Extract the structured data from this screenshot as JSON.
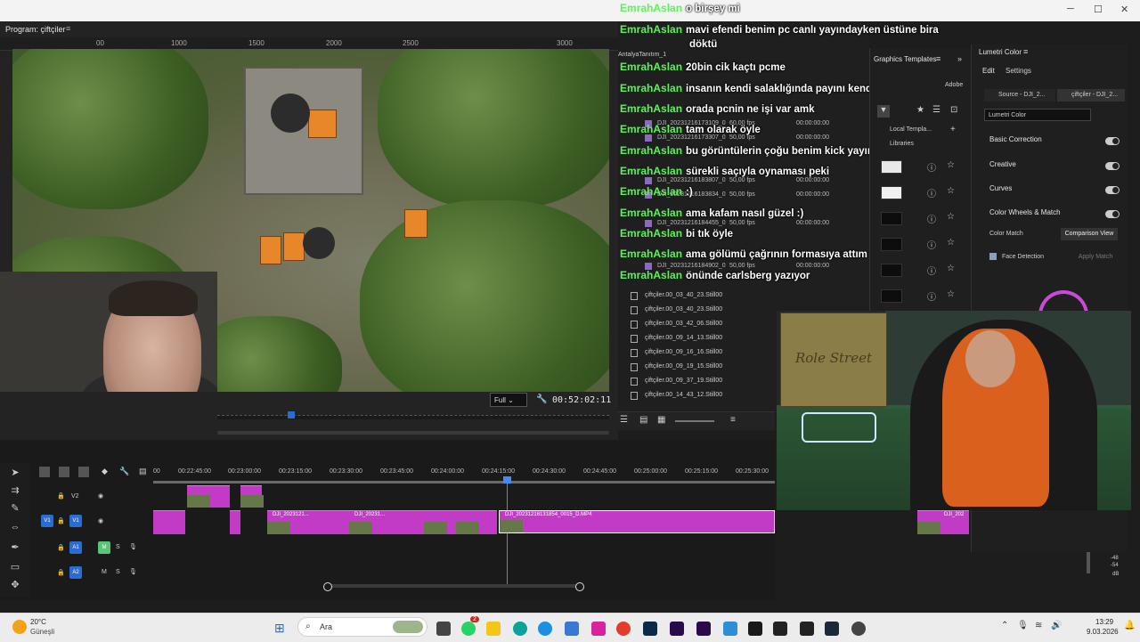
{
  "program": {
    "tab_label": "Program: çiftçiler",
    "ruler": [
      "00",
      "1000",
      "1500",
      "2000",
      "2500",
      "3000"
    ],
    "fit": "Full",
    "timecode": "00:52:02:11"
  },
  "project": {
    "bin_label": "AntalyaTanıtım_1",
    "clips": [
      {
        "name": "DJI_20231216173109_0",
        "fps": "60,00 fps",
        "tc": "00:00:00:00"
      },
      {
        "name": "DJI_20231216173307_0",
        "fps": "50,00 fps",
        "tc": "00:00:00:00"
      },
      {
        "name": "DJI_20231216183807_0",
        "fps": "50,00 fps",
        "tc": "00:00:00:00"
      },
      {
        "name": "DJI_20231216183834_0",
        "fps": "50,00 fps",
        "tc": "00:00:00:00"
      },
      {
        "name": "DJI_20231216184455_0",
        "fps": "50,00 fps",
        "tc": "00:00:00:00"
      },
      {
        "name": "DJI_20231216184902_0",
        "fps": "50,00 fps",
        "tc": "00:00:00:00"
      }
    ],
    "stills": [
      "çiftçiler.00_03_40_23.Still00",
      "çiftçiler.00_03_40_23.Still00",
      "çiftçiler.00_03_42_06.Still00",
      "çiftçiler.00_09_14_13.Still00",
      "çiftçiler.00_09_16_16.Still00",
      "çiftçiler.00_09_19_15.Still00",
      "çiftçiler.00_09_37_19.Still00",
      "çiftçiler.00_14_43_12.Still00"
    ]
  },
  "chat": [
    {
      "user": "EmrahAslan",
      "msg": "o birşey mi"
    },
    {
      "user": "EmrahAslan",
      "msg": "mavi efendi benim pc canlı yayındayken üstüne bira"
    },
    {
      "user": "",
      "msg": "döktü"
    },
    {
      "user": "EmrahAslan",
      "msg": "20bin cik kaçtı pcme"
    },
    {
      "user": "EmrahAslan",
      "msg": "insanın kendi salaklığında payını kendin çekersin"
    },
    {
      "user": "EmrahAslan",
      "msg": "orada pcnin ne işi var amk"
    },
    {
      "user": "EmrahAslan",
      "msg": "tam olarak öyle"
    },
    {
      "user": "EmrahAslan",
      "msg": "bu görüntülerin çoğu benim kick yayınından"
    },
    {
      "user": "EmrahAslan",
      "msg": "sürekli saçıyla oynaması peki"
    },
    {
      "user": "EmrahAslan",
      "msg": ":)"
    },
    {
      "user": "EmrahAslan",
      "msg": "ama kafam nasıl güzel :)"
    },
    {
      "user": "EmrahAslan",
      "msg": "bi tık öyle"
    },
    {
      "user": "EmrahAslan",
      "msg": "ama gölümü çağrının formasıya attım"
    },
    {
      "user": "EmrahAslan",
      "msg": "önünde carlsberg yazıyor"
    }
  ],
  "graphics": {
    "title": "Graphics Templates",
    "adobe": "Adobe",
    "local": "Local Templa...",
    "libraries": "Libraries"
  },
  "lumetri": {
    "title": "Lumetri Color",
    "edit": "Edit",
    "settings": "Settings",
    "source": "Source - DJI_2...",
    "seq": "çiftçiler - DJI_2...",
    "preset": "Lumetri Color",
    "sections": [
      "Basic Correction",
      "Creative",
      "Curves",
      "Color Wheels & Match"
    ],
    "color_match": "Color Match",
    "comparison": "Comparison View",
    "face_detection": "Face Detection",
    "apply_match": "Apply Match",
    "db": [
      "-48",
      "-54",
      "dB"
    ]
  },
  "timeline": {
    "ruler": [
      "00",
      "00:22:45:00",
      "00:23:00:00",
      "00:23:15:00",
      "00:23:30:00",
      "00:23:45:00",
      "00:24:00:00",
      "00:24:15:00",
      "00:24:30:00",
      "00:24:45:00",
      "00:25:00:00",
      "00:25:15:00",
      "00:25:30:00"
    ],
    "tracks": {
      "v2": "V2",
      "v1": "V1",
      "a1": "A1",
      "a2": "A2",
      "m": "M",
      "s": "S"
    },
    "clip_labels": [
      "DJI_2023121...",
      "DJI_20231...",
      "DJI_20231216131854_0015_D.MP4",
      "DJI_202"
    ]
  },
  "taskbar": {
    "weather_temp": "20°C",
    "weather_desc": "Güneşli",
    "search": "Ara",
    "time": "13:29",
    "date": "9.03.2026",
    "badge": "2"
  },
  "colors": {
    "accent": "#2a6ccf",
    "clip": "#c23bc7",
    "chat_user": "#5df25a"
  }
}
